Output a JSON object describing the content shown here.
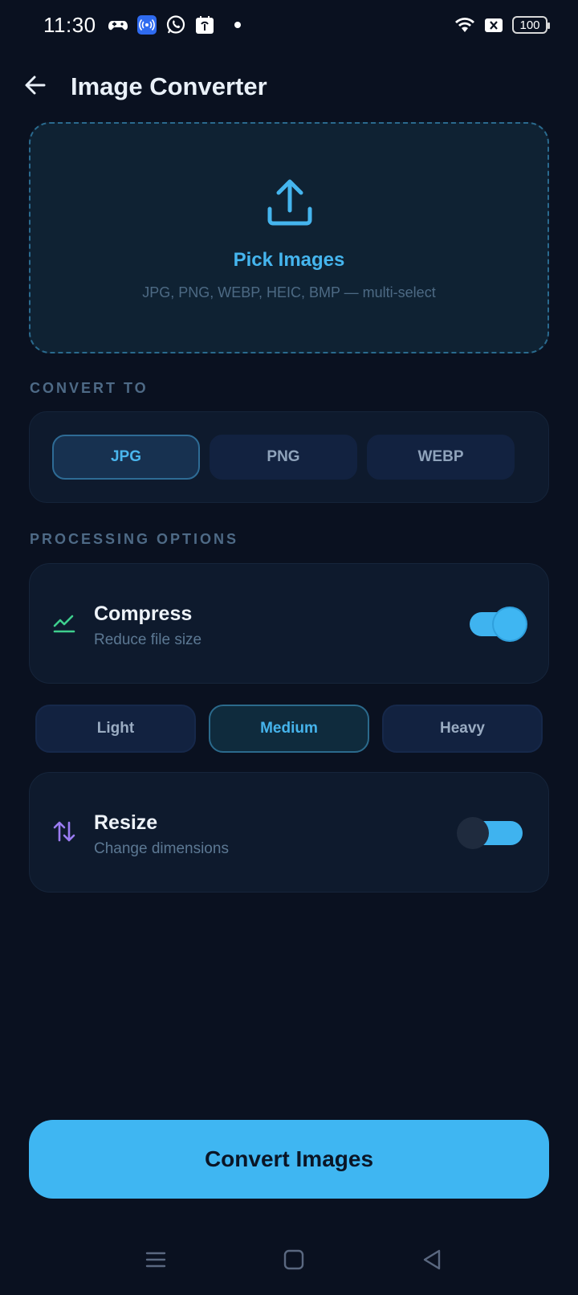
{
  "status_bar": {
    "time": "11:30",
    "battery": "100",
    "icons": [
      "gamepad-icon",
      "broadcast-icon",
      "whatsapp-icon",
      "store-icon",
      "dot-icon",
      "wifi-icon",
      "x-box-icon",
      "battery-icon"
    ]
  },
  "header": {
    "title": "Image Converter",
    "back_icon": "arrow-left-icon"
  },
  "picker": {
    "icon": "upload-icon",
    "title": "Pick Images",
    "subtitle": "JPG, PNG, WEBP, HEIC, BMP — multi-select"
  },
  "convert_to": {
    "label": "CONVERT TO",
    "options": [
      {
        "label": "JPG",
        "selected": true
      },
      {
        "label": "PNG",
        "selected": false
      },
      {
        "label": "WEBP",
        "selected": false
      }
    ]
  },
  "processing": {
    "label": "PROCESSING OPTIONS",
    "compress": {
      "title": "Compress",
      "subtitle": "Reduce file size",
      "icon": "trending-up-icon",
      "enabled": true,
      "levels": [
        {
          "label": "Light",
          "selected": false
        },
        {
          "label": "Medium",
          "selected": true
        },
        {
          "label": "Heavy",
          "selected": false
        }
      ]
    },
    "resize": {
      "title": "Resize",
      "subtitle": "Change dimensions",
      "icon": "swap-vertical-icon",
      "enabled": false
    }
  },
  "action": {
    "label": "Convert Images"
  },
  "colors": {
    "background": "#0a1120",
    "accent": "#3fb6f2",
    "card": "#0e1a2d",
    "compress_icon": "#3ecf8e",
    "resize_icon": "#9b7cf2"
  }
}
